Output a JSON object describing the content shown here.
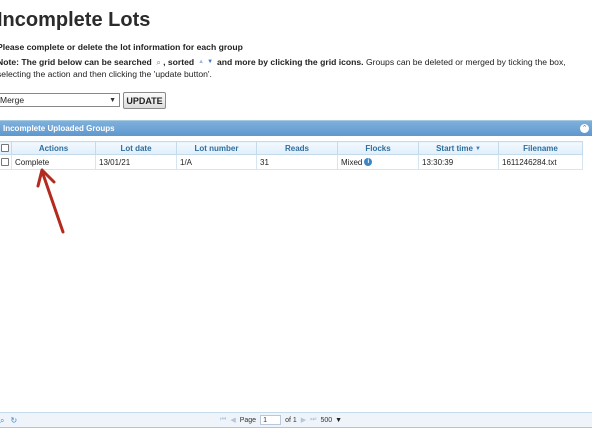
{
  "page": {
    "title": "Incomplete Lots",
    "intro": "Please complete or delete the lot information for each group",
    "note": {
      "prefix_bold": "Note: The grid below can be searched",
      "search_icon": "search-icon",
      "sorted_bold": ", sorted",
      "more_bold": "and more by clicking the grid icons.",
      "rest": " Groups can be deleted or merged by ticking the box,",
      "line2": "selecting the action and then clicking the 'update button'."
    }
  },
  "controls": {
    "action_select_value": "Merge",
    "update_label": "UPDATE"
  },
  "grid": {
    "title": "Incomplete Uploaded Groups",
    "columns": [
      "Actions",
      "Lot date",
      "Lot number",
      "Reads",
      "Flocks",
      "Start time",
      "Filename"
    ],
    "rows": [
      {
        "action": "Complete",
        "lot_date": "13/01/21",
        "lot_number": "1/A",
        "reads": "31",
        "flocks": "Mixed",
        "start_time": "13:30:39",
        "filename": "1611246284.txt"
      }
    ],
    "pager": {
      "page_label": "Page",
      "page_value": "1",
      "of_label": "of 1",
      "rows_per_page": "500"
    }
  },
  "colors": {
    "header_bar": "#5f98cf",
    "column_header_text": "#2e6e9e",
    "annotation_arrow": "#b32a1e"
  }
}
